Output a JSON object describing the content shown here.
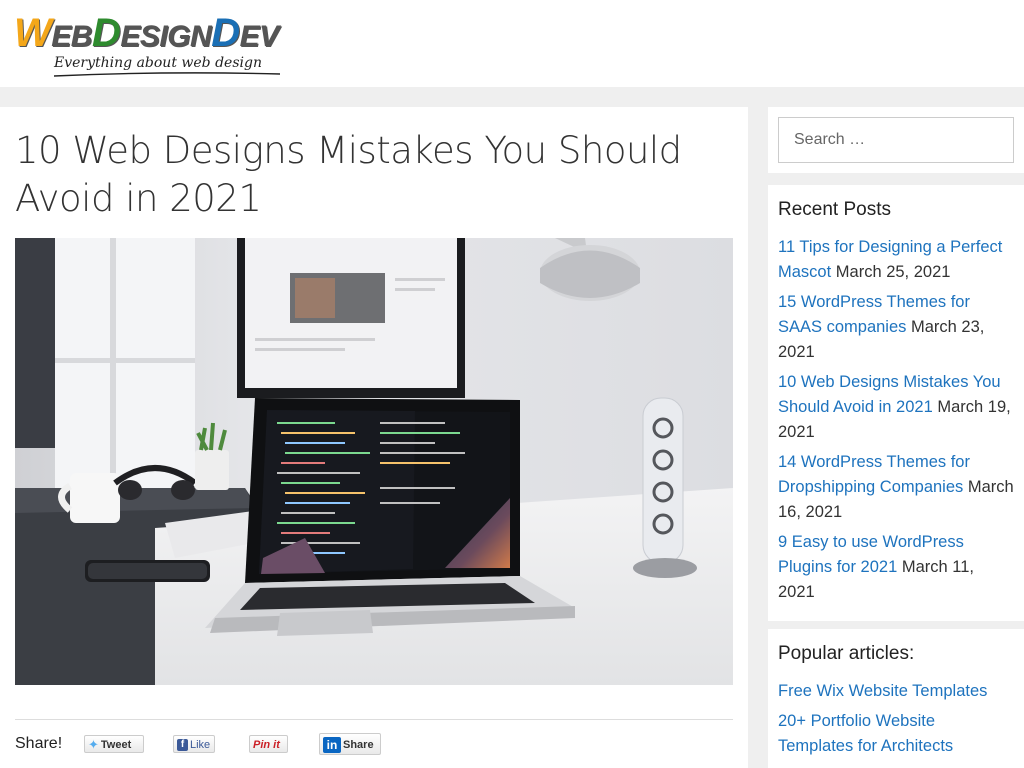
{
  "logo": {
    "part_w": "W",
    "part_eb": "EB",
    "part_d1": "D",
    "part_esign": "ESIGN",
    "part_d2": "D",
    "part_ev": "EV",
    "tagline": "Everything about web design"
  },
  "post": {
    "title": "10 Web Designs Mistakes You Should Avoid in 2021",
    "image_subject": "laptop-with-code-on-desk"
  },
  "share": {
    "label": "Share!",
    "tweet": "Tweet",
    "like": "Like",
    "pin": "Pin it",
    "linkedin": "Share",
    "linkedin_icon": "in"
  },
  "search": {
    "placeholder": "Search …"
  },
  "recent": {
    "title": "Recent Posts",
    "items": [
      {
        "link": "11 Tips for Designing a Perfect Mascot",
        "date": "March 25, 2021"
      },
      {
        "link": "15 WordPress Themes for SAAS companies",
        "date": "March 23, 2021"
      },
      {
        "link": "10 Web Designs Mistakes You Should Avoid in 2021",
        "date": "March 19, 2021"
      },
      {
        "link": "14 WordPress Themes for Dropshipping Companies",
        "date": "March 16, 2021"
      },
      {
        "link": "9 Easy to use WordPress Plugins for 2021",
        "date": "March 11, 2021"
      }
    ]
  },
  "popular": {
    "title": "Popular articles:",
    "items": [
      {
        "link": "Free Wix Website Templates"
      },
      {
        "link": "20+ Portfolio Website Templates for Architects"
      }
    ]
  },
  "colors": {
    "link": "#1e73be",
    "page_bg": "#efefef",
    "logo_orange": "#f4a71a",
    "logo_green": "#2e8b2e",
    "logo_blue": "#1a6fb5"
  }
}
